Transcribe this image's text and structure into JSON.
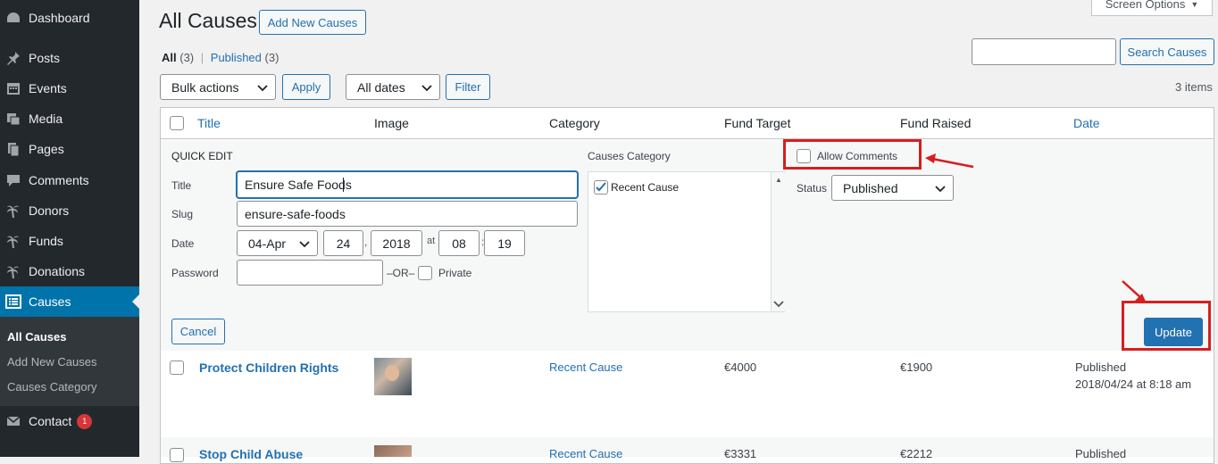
{
  "sidebar": {
    "items": [
      {
        "label": "Dashboard",
        "icon": "dashboard-icon"
      },
      {
        "label": "Posts",
        "icon": "pin-icon"
      },
      {
        "label": "Events",
        "icon": "calendar-icon"
      },
      {
        "label": "Media",
        "icon": "media-icon"
      },
      {
        "label": "Pages",
        "icon": "pages-icon"
      },
      {
        "label": "Comments",
        "icon": "comment-icon"
      },
      {
        "label": "Donors",
        "icon": "palm-icon"
      },
      {
        "label": "Funds",
        "icon": "palm-icon"
      },
      {
        "label": "Donations",
        "icon": "palm-icon"
      },
      {
        "label": "Causes",
        "icon": "list-icon"
      },
      {
        "label": "Contact",
        "icon": "mail-icon",
        "badge": "1"
      }
    ],
    "submenu": [
      "All Causes",
      "Add New Causes",
      "Causes Category"
    ]
  },
  "header": {
    "title": "All Causes",
    "add_new": "Add New Causes",
    "screen_options": "Screen Options"
  },
  "filters": {
    "all_label": "All",
    "all_count": "(3)",
    "separator": "|",
    "published_label": "Published",
    "published_count": "(3)",
    "bulk_actions": "Bulk actions",
    "apply": "Apply",
    "all_dates": "All dates",
    "filter": "Filter",
    "items_count": "3 items",
    "search_button": "Search Causes",
    "search_value": ""
  },
  "table": {
    "columns": [
      "Title",
      "Image",
      "Category",
      "Fund Target",
      "Fund Raised",
      "Date"
    ],
    "rows": [
      {
        "title": "Protect Children Rights",
        "category": "Recent Cause",
        "target": "€4000",
        "raised": "€1900",
        "status": "Published",
        "date": "2018/04/24 at 8:18 am"
      },
      {
        "title": "Stop Child Abuse",
        "category": "Recent Cause",
        "target": "€3331",
        "raised": "€2212",
        "status": "Published"
      }
    ]
  },
  "quick_edit": {
    "heading": "QUICK EDIT",
    "title_label": "Title",
    "title_value": "Ensure Safe Foods",
    "slug_label": "Slug",
    "slug_value": "ensure-safe-foods",
    "date_label": "Date",
    "month": "04-Apr",
    "day": "24",
    "comma": ",",
    "year": "2018",
    "at": "at",
    "hour": "08",
    "colon": ":",
    "minute": "19",
    "password_label": "Password",
    "password_value": "",
    "or": "–OR–",
    "private": "Private",
    "causes_category": "Causes Category",
    "category_item": "Recent Cause",
    "allow_comments": "Allow Comments",
    "status_label": "Status",
    "status_value": "Published",
    "cancel": "Cancel",
    "update": "Update"
  },
  "colors": {
    "accent": "#2271b1",
    "sidebar": "#23282d",
    "highlight": "#d71e1e"
  }
}
